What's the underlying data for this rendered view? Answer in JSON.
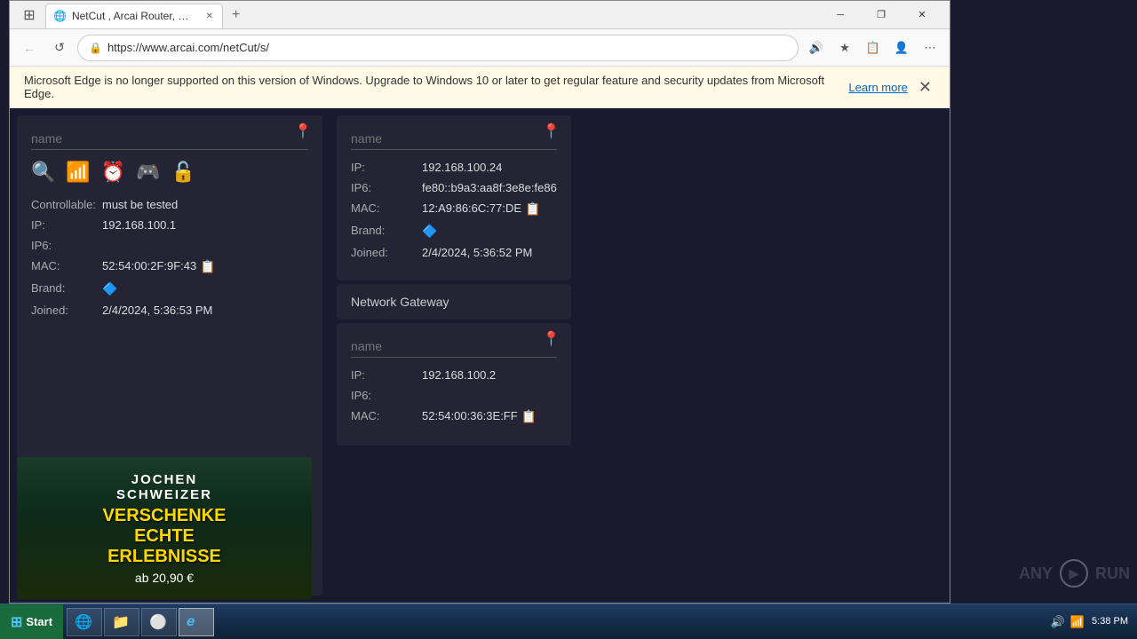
{
  "browser": {
    "tab_title": "NetCut , Arcai Router, Wifi Spe...",
    "url": "https://www.arcai.com/netCut/s/",
    "back_disabled": true,
    "forward_disabled": true
  },
  "info_bar": {
    "message": "Microsoft Edge is no longer supported on this version of Windows. Upgrade to Windows 10 or later to get regular feature and security updates from Microsoft Edge.",
    "learn_more": "Learn more"
  },
  "left_device": {
    "name_placeholder": "name",
    "name_value": "",
    "controllable_label": "Controllable:",
    "controllable_value": "must be tested",
    "ip_label": "IP:",
    "ip_value": "192.168.100.1",
    "ip6_label": "IP6:",
    "ip6_value": "",
    "mac_label": "MAC:",
    "mac_value": "52:54:00:2F:9F:43",
    "brand_label": "Brand:",
    "joined_label": "Joined:",
    "joined_value": "2/4/2024, 5:36:53 PM"
  },
  "right_device_top": {
    "name_placeholder": "name",
    "ip_label": "IP:",
    "ip_value": "192.168.100.24",
    "ip6_label": "IP6:",
    "ip6_value": "fe80::b9a3:aa8f:3e8e:fe86",
    "mac_label": "MAC:",
    "mac_value": "12:A9:86:6C:77:DE",
    "brand_label": "Brand:",
    "joined_label": "Joined:",
    "joined_value": "2/4/2024, 5:36:52 PM"
  },
  "network_gateway": {
    "label": "Network Gateway"
  },
  "right_device_bottom": {
    "name_placeholder": "name",
    "ip_label": "IP:",
    "ip_value": "192.168.100.2",
    "ip6_label": "IP6:",
    "ip6_value": "",
    "mac_label": "MAC:",
    "mac_value": "52:54:00:36:3E:FF"
  },
  "ad": {
    "brand_top": "JOCHEN",
    "brand_bottom": "SCHWEIZER",
    "headline1": "VERSCHENKE",
    "headline2": "ECHTE",
    "headline3": "ERLEBNISSE",
    "price": "ab 20,90 €",
    "close": "×"
  },
  "taskbar": {
    "start_label": "Start",
    "time": "5:38 PM",
    "app_icons": [
      "IE",
      "Explorer",
      "Chrome",
      "Edge"
    ]
  },
  "watermark": {
    "text": "ANY",
    "text2": "RUN"
  }
}
